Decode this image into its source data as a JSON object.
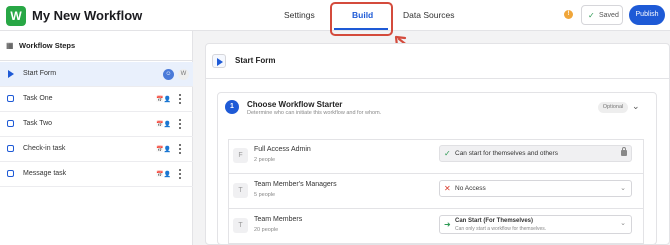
{
  "header": {
    "logo_letter": "W",
    "title": "My New Workflow",
    "tabs": [
      {
        "label": "Settings"
      },
      {
        "label": "Build"
      },
      {
        "label": "Data Sources"
      }
    ],
    "warning_symbol": "!",
    "saved_label": "Saved",
    "publish_label": "Publish"
  },
  "sidebar": {
    "title": "Workflow Steps",
    "steps": [
      {
        "label": "Start Form",
        "avatar": "☺",
        "badge": "W"
      },
      {
        "label": "Task One"
      },
      {
        "label": "Task Two"
      },
      {
        "label": "Check-in task"
      },
      {
        "label": "Message task"
      }
    ]
  },
  "main": {
    "section_title": "Start Form",
    "starter": {
      "number": "1",
      "title": "Choose Workflow Starter",
      "subtitle": "Determine who can initiate this workflow and for whom.",
      "optional_label": "Optional"
    },
    "permissions": [
      {
        "initial": "F",
        "name": "Full Access Admin",
        "count": "2 people",
        "value": "Can start for themselves and others",
        "status": "allowed",
        "locked": true
      },
      {
        "initial": "T",
        "name": "Team Member's Managers",
        "count": "5 people",
        "value": "No Access",
        "status": "denied"
      },
      {
        "initial": "T",
        "name": "Team Members",
        "count": "20 people",
        "value": "Can Start (For Themselves)",
        "subtext": "Can only start a workflow for themselves.",
        "status": "self"
      }
    ]
  },
  "colors": {
    "accent": "#1e5ad6",
    "logo": "#28a745",
    "highlight": "#d44b3c",
    "allowed": "#2f9a55",
    "denied": "#d93a2b",
    "warning": "#f0a63a"
  }
}
